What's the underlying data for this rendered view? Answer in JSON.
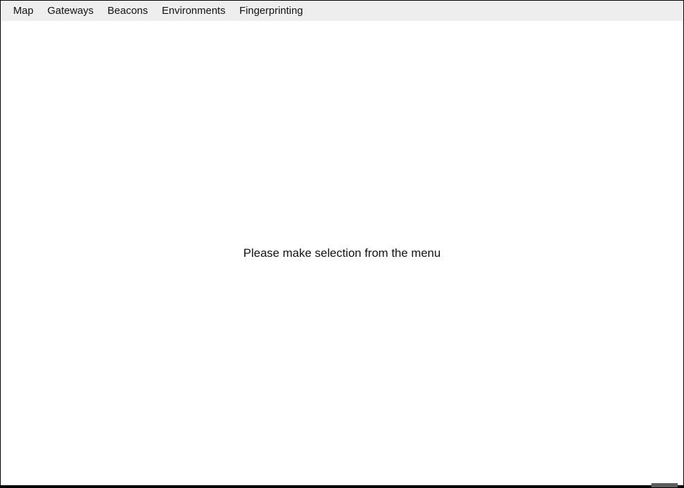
{
  "menubar": {
    "items": [
      {
        "label": "Map"
      },
      {
        "label": "Gateways"
      },
      {
        "label": "Beacons"
      },
      {
        "label": "Environments"
      },
      {
        "label": "Fingerprinting"
      }
    ]
  },
  "main": {
    "message": "Please make selection from the menu"
  }
}
